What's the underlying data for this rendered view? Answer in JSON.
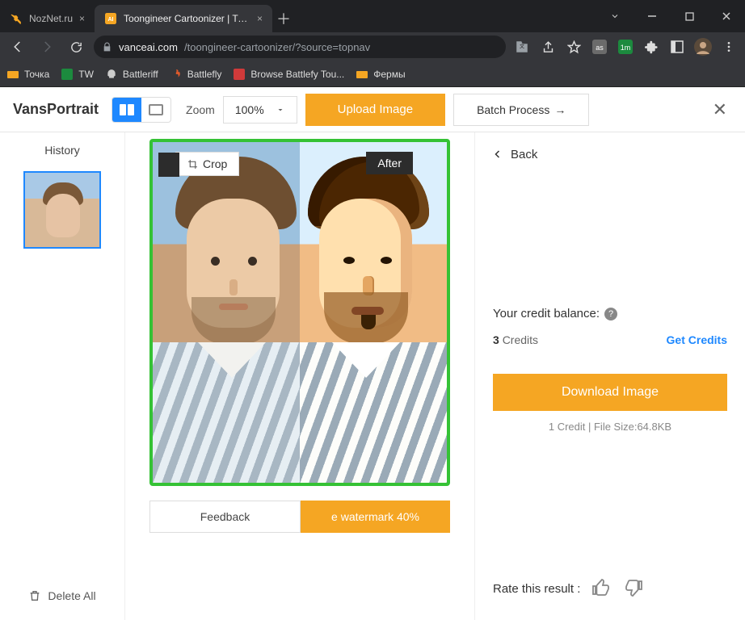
{
  "browser": {
    "tabs": [
      {
        "title": "NozNet.ru",
        "active": false
      },
      {
        "title": "Toongineer Cartoonizer | Turn Ph",
        "active": true
      }
    ],
    "url_host": "vanceai.com",
    "url_path": "/toongineer-cartoonizer/?source=topnav",
    "bookmarks": [
      "Точка",
      "TW",
      "Battleriff",
      "Battlefly",
      "Browse Battlefy Tou...",
      "Фермы"
    ]
  },
  "toolbar": {
    "brand": "VansPortrait",
    "zoom_label": "Zoom",
    "zoom_value": "100%",
    "upload_label": "Upload Image",
    "batch_label": "Batch Process",
    "batch_arrow": "→"
  },
  "left": {
    "history_label": "History",
    "delete_all_label": "Delete All"
  },
  "center": {
    "crop_label": "Crop",
    "after_label": "After",
    "feedback_label": "Feedback",
    "watermark_label": "e watermark 40%"
  },
  "right": {
    "back_label": "Back",
    "credit_balance_label": "Your credit balance:",
    "credit_count": "3",
    "credit_unit": "Credits",
    "get_credits_label": "Get Credits",
    "download_label": "Download Image",
    "download_meta": "1 Credit | File Size:64.8KB",
    "rate_label": "Rate this result :"
  }
}
